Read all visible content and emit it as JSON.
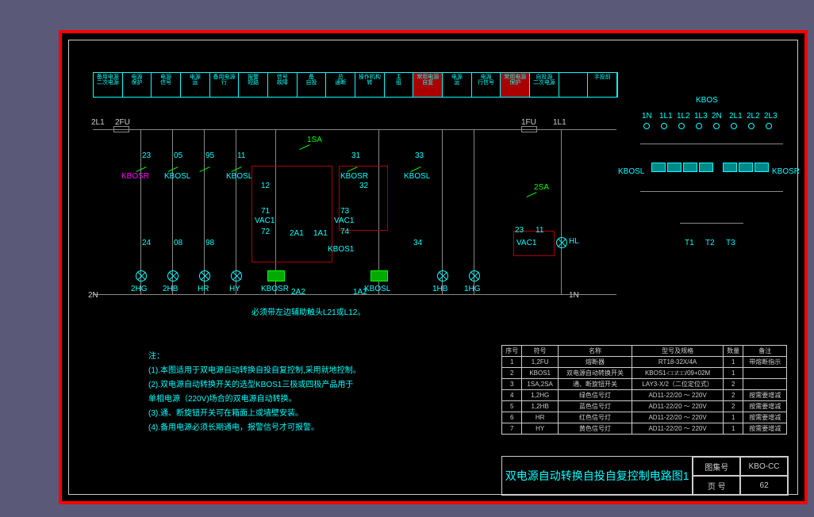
{
  "terminal_row": [
    "备用电源/二次电源",
    "电源/保护",
    "电源/信号",
    "电源/运",
    "备用电源/行",
    "报警/短路",
    "信号/故障",
    "备/自投",
    "总/通断",
    "操作机构/转",
    "主/组",
    "常用电源/自复",
    "电源/运",
    "电源/行信号",
    "常用电源/保护",
    "自投源/二次电源",
    "",
    "手投前"
  ],
  "terminal_red": [
    11,
    14
  ],
  "labels": {
    "l2l1": "2L1",
    "l2fu": "2FU",
    "l1fu": "1FU",
    "l1l1": "1L1",
    "n23": "23",
    "n05": "05",
    "n95": "95",
    "n11": "11",
    "n31": "31",
    "n33": "33",
    "n24": "24",
    "n08": "08",
    "n98": "98",
    "n71": "71",
    "n73": "73",
    "n72": "72",
    "n74": "74",
    "n34": "34",
    "n12": "12",
    "n32": "32",
    "n2a1": "2A1",
    "n1a1": "1A1",
    "n2a2": "2A2",
    "n1a2": "1A2",
    "k1": "KBOSR",
    "k2": "KBOSL",
    "k3": "KBOSL",
    "k4": "KBOSR",
    "k5": "KBOSL",
    "vac1": "VAC1",
    "vac2": "VAC1",
    "vac3": "VAC1",
    "isa1": "1SA",
    "sa2": "2SA",
    "k1s": "KBOS1",
    "hl": "HL",
    "lhg2": "2HG",
    "lhb2": "2HB",
    "lhr": "HR",
    "lhy": "HY",
    "kbosr": "KBOSR",
    "kbosl": "KBOSL",
    "lhb1": "1HB",
    "lhg1": "1HG",
    "n2n": "2N",
    "n1n": "1N",
    "n23_2": "23",
    "n11_2": "11",
    "footnote": "必须带左边辅助触头L21或L12。"
  },
  "kbos": {
    "title": "KBOS",
    "top": [
      "1N",
      "1L1",
      "1L2",
      "1L3",
      "2N",
      "2L1",
      "2L2",
      "2L3"
    ],
    "left": "KBOSL",
    "right": "KBOSR",
    "bot": [
      "T1",
      "T2",
      "T3"
    ]
  },
  "notes": {
    "hdr": "注：",
    "n1": "(1).本图适用于双电源自动转换自投自复控制,采用就地控制。",
    "n2": "(2).双电源自动转换开关的选型KBOS1三极或四极产品用于",
    "n2b": "    单相电源（220V)场合的双电源自动转换。",
    "n3": "(3).通、断旋钮开关可在箱面上或墙壁安装。",
    "n4": "(4).备用电源必须长期通电，报警信号才可报警。"
  },
  "parts_hdr": [
    "序号",
    "符号",
    "名称",
    "型号及规格",
    "数量",
    "备注"
  ],
  "parts": [
    [
      "1",
      "1,2FU",
      "熔断器",
      "RT18-32X/4A",
      "1",
      "带熔断指示"
    ],
    [
      "2",
      "KBOS1",
      "双电源自动转换开关",
      "KBOS1-□□/□□/09+02M",
      "1",
      ""
    ],
    [
      "3",
      "1SA,2SA",
      "通、断旋钮开关",
      "LAY3-X/2（二位定位式）",
      "2",
      ""
    ],
    [
      "4",
      "1,2HG",
      "绿色信号灯",
      "AD11-22/20 ～ 220V",
      "2",
      "按需要增减"
    ],
    [
      "5",
      "1,2HB",
      "蓝色信号灯",
      "AD11-22/20 ～ 220V",
      "2",
      "按需要增减"
    ],
    [
      "6",
      "HR",
      "红色信号灯",
      "AD11-22/20 ～ 220V",
      "1",
      "按需要增减"
    ],
    [
      "7",
      "HY",
      "黄色信号灯",
      "AD11-22/20 ～ 220V",
      "1",
      "按需要增减"
    ]
  ],
  "title": {
    "main": "双电源自动转换自投自复控制电路图1",
    "setlbl": "图集号",
    "setval": "KBO-CC",
    "pglbl": "页 号",
    "pgval": "62"
  }
}
